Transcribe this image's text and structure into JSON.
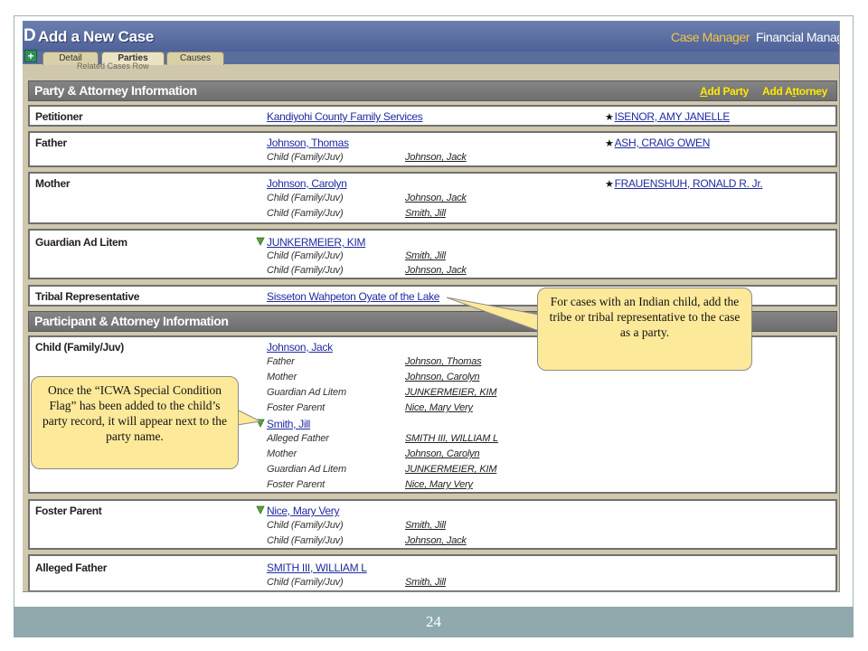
{
  "app": {
    "title_prefix": "D",
    "title": "Add a New Case",
    "top_links": [
      "Case Manager",
      "Financial Manag"
    ],
    "add_icon": "+",
    "tabs": [
      "Detail",
      "Parties",
      "Causes"
    ],
    "hidden_text": "Related Cases Row",
    "colors": {
      "header": "#4e629a",
      "section": "#6e6e6e",
      "link": "#1f2ba0",
      "highlight": "#ffea00",
      "callout": "#fde99a"
    }
  },
  "sections": {
    "party": {
      "title": "Party & Attorney Information",
      "add_party": {
        "first": "A",
        "rest": "dd Party"
      },
      "add_attorney": {
        "start": "Add A",
        "underline": "t",
        "end": "torney"
      }
    },
    "participant": {
      "title": "Participant & Attorney Information"
    }
  },
  "rows": {
    "petitioner": {
      "role": "Petitioner",
      "party": "Kandiyohi County Family Services",
      "attorney": "ISENOR, AMY JANELLE"
    },
    "father": {
      "role": "Father",
      "party": "Johnson, Thomas",
      "attorney": "ASH, CRAIG OWEN",
      "relations": [
        {
          "type": "Child (Family/Juv)",
          "name": "Johnson, Jack"
        }
      ]
    },
    "mother": {
      "role": "Mother",
      "party": "Johnson, Carolyn",
      "attorney": "FRAUENSHUH, RONALD R. Jr.",
      "relations": [
        {
          "type": "Child (Family/Juv)",
          "name": "Johnson, Jack"
        },
        {
          "type": "Child (Family/Juv)",
          "name": "Smith, Jill"
        }
      ]
    },
    "gal": {
      "role": "Guardian Ad Litem",
      "party": "JUNKERMEIER, KIM",
      "relations": [
        {
          "type": "Child (Family/Juv)",
          "name": "Smith, Jill"
        },
        {
          "type": "Child (Family/Juv)",
          "name": "Johnson, Jack"
        }
      ]
    },
    "tribal": {
      "role": "Tribal Representative",
      "party": "Sisseton Wahpeton Oyate of the Lake"
    },
    "child": {
      "role": "Child (Family/Juv)",
      "party1": "Johnson, Jack",
      "relations1": [
        {
          "type": "Father",
          "name": "Johnson, Thomas"
        },
        {
          "type": "Mother",
          "name": "Johnson, Carolyn"
        },
        {
          "type": "Guardian Ad Litem",
          "name": "JUNKERMEIER, KIM"
        },
        {
          "type": "Foster Parent",
          "name": "Nice, Mary Very"
        }
      ],
      "party2": "Smith, Jill",
      "relations2": [
        {
          "type": "Alleged Father",
          "name": "SMITH III, WILLIAM L"
        },
        {
          "type": "Mother",
          "name": "Johnson, Carolyn"
        },
        {
          "type": "Guardian Ad Litem",
          "name": "JUNKERMEIER, KIM"
        },
        {
          "type": "Foster Parent",
          "name": "Nice, Mary Very"
        }
      ]
    },
    "foster": {
      "role": "Foster Parent",
      "party": "Nice, Mary Very",
      "relations": [
        {
          "type": "Child (Family/Juv)",
          "name": "Smith, Jill"
        },
        {
          "type": "Child (Family/Juv)",
          "name": "Johnson, Jack"
        }
      ]
    },
    "alleged": {
      "role": "Alleged Father",
      "party": "SMITH III, WILLIAM L",
      "relations": [
        {
          "type": "Child (Family/Juv)",
          "name": "Smith, Jill"
        }
      ]
    }
  },
  "callouts": {
    "tribe_note": "For cases with an Indian child, add the tribe or  tribal representative to the case as a party.",
    "flag_note": "Once the “ICWA Special Condition Flag” has been added to the child’s party record, it will  appear next to the party name."
  },
  "footer": {
    "page_number": "24"
  }
}
